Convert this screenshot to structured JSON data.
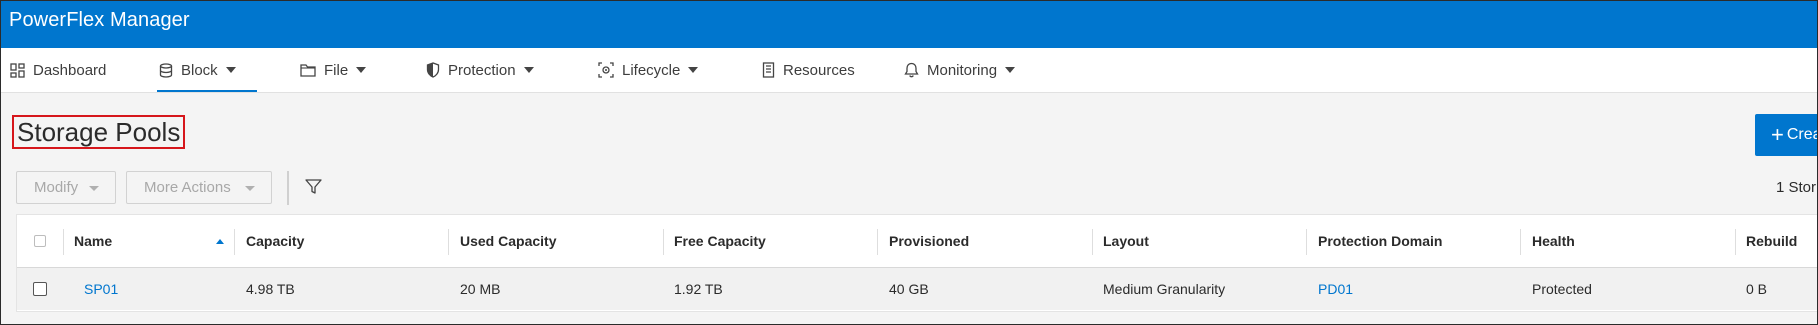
{
  "header": {
    "title": "PowerFlex Manager"
  },
  "nav": {
    "items": [
      {
        "label": "Dashboard",
        "icon": "dashboard-icon",
        "has_menu": false
      },
      {
        "label": "Block",
        "icon": "block-storage-icon",
        "has_menu": true,
        "active": true
      },
      {
        "label": "File",
        "icon": "folder-icon",
        "has_menu": true
      },
      {
        "label": "Protection",
        "icon": "shield-icon",
        "has_menu": true
      },
      {
        "label": "Lifecycle",
        "icon": "lifecycle-icon",
        "has_menu": true
      },
      {
        "label": "Resources",
        "icon": "resources-icon",
        "has_menu": false
      },
      {
        "label": "Monitoring",
        "icon": "bell-icon",
        "has_menu": true
      }
    ]
  },
  "page": {
    "title": "Storage Pools"
  },
  "actions": {
    "create_label": "Crea",
    "create_icon": "plus-icon"
  },
  "toolbar": {
    "modify_label": "Modify",
    "more_actions_label": "More Actions",
    "filter_icon": "filter-icon",
    "count_text": "1 Stor"
  },
  "table": {
    "columns": [
      "Name",
      "Capacity",
      "Used Capacity",
      "Free Capacity",
      "Provisioned",
      "Layout",
      "Protection Domain",
      "Health",
      "Rebuild"
    ],
    "sort": {
      "column": "Name",
      "direction": "ascending"
    },
    "rows": [
      {
        "name": "SP01",
        "capacity": "4.98 TB",
        "used_capacity": "20 MB",
        "free_capacity": "1.92 TB",
        "provisioned": "40 GB",
        "layout": "Medium Granularity",
        "protection_domain": "PD01",
        "health": "Protected",
        "rebuild": "0 B"
      }
    ]
  },
  "colors": {
    "brand": "#0076ce",
    "highlight": "#d6161b",
    "link": "#0076ce"
  }
}
